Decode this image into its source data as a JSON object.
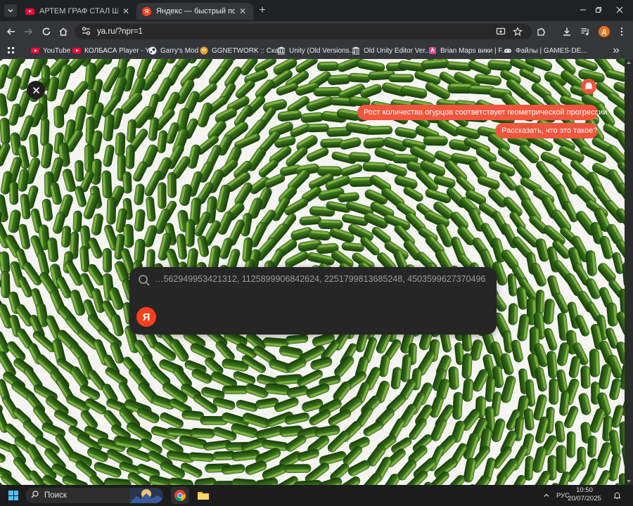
{
  "tabs": [
    {
      "title": "АРТЕМ ГРАФ СТАЛ ШЕСТЕРКОЙ",
      "favicon": "youtube-icon",
      "active": false
    },
    {
      "title": "Яндекс — быстрый поиск в интернете",
      "favicon": "yandex-icon",
      "active": true
    }
  ],
  "address_bar": {
    "url": "ya.ru/?npr=1"
  },
  "profile": {
    "initial": "Д"
  },
  "bookmarks": [
    {
      "label": "YouTube",
      "icon": "youtube-icon"
    },
    {
      "label": "КОЛБАСА Player - Y...",
      "icon": "youtube-icon"
    },
    {
      "label": "Garry's Mod",
      "icon": "steam-icon"
    },
    {
      "label": "GGNETWORK :: Ска...",
      "icon": "ggnetwork-icon"
    },
    {
      "label": "Unity (Old Versions...",
      "icon": "archive-icon"
    },
    {
      "label": "Old Unity Editor Ver...",
      "icon": "archive-icon"
    },
    {
      "label": "Brian Maps вики | F...",
      "icon": "fandom-icon"
    },
    {
      "label": "Файлы | GAMES-DE...",
      "icon": "gamepad-icon"
    }
  ],
  "page": {
    "pill_fact": "Рост количества огурцов соответствует геометрической прогрессии",
    "pill_ask": "Рассказать, что это такое?",
    "search_query": "…562949953421312, 1125899906842624, 2251799813685248, 4503599627370496",
    "logo_letter": "Я"
  },
  "taskbar": {
    "search_placeholder": "Поиск",
    "language": "РУС",
    "time": "10:50",
    "date": "20/07/2025"
  },
  "colors": {
    "accent_red": "#f2553d",
    "yandex_red": "#fc3f1d",
    "chrome_dark": "#202124",
    "cucumber_green": "#3f7a1e"
  }
}
